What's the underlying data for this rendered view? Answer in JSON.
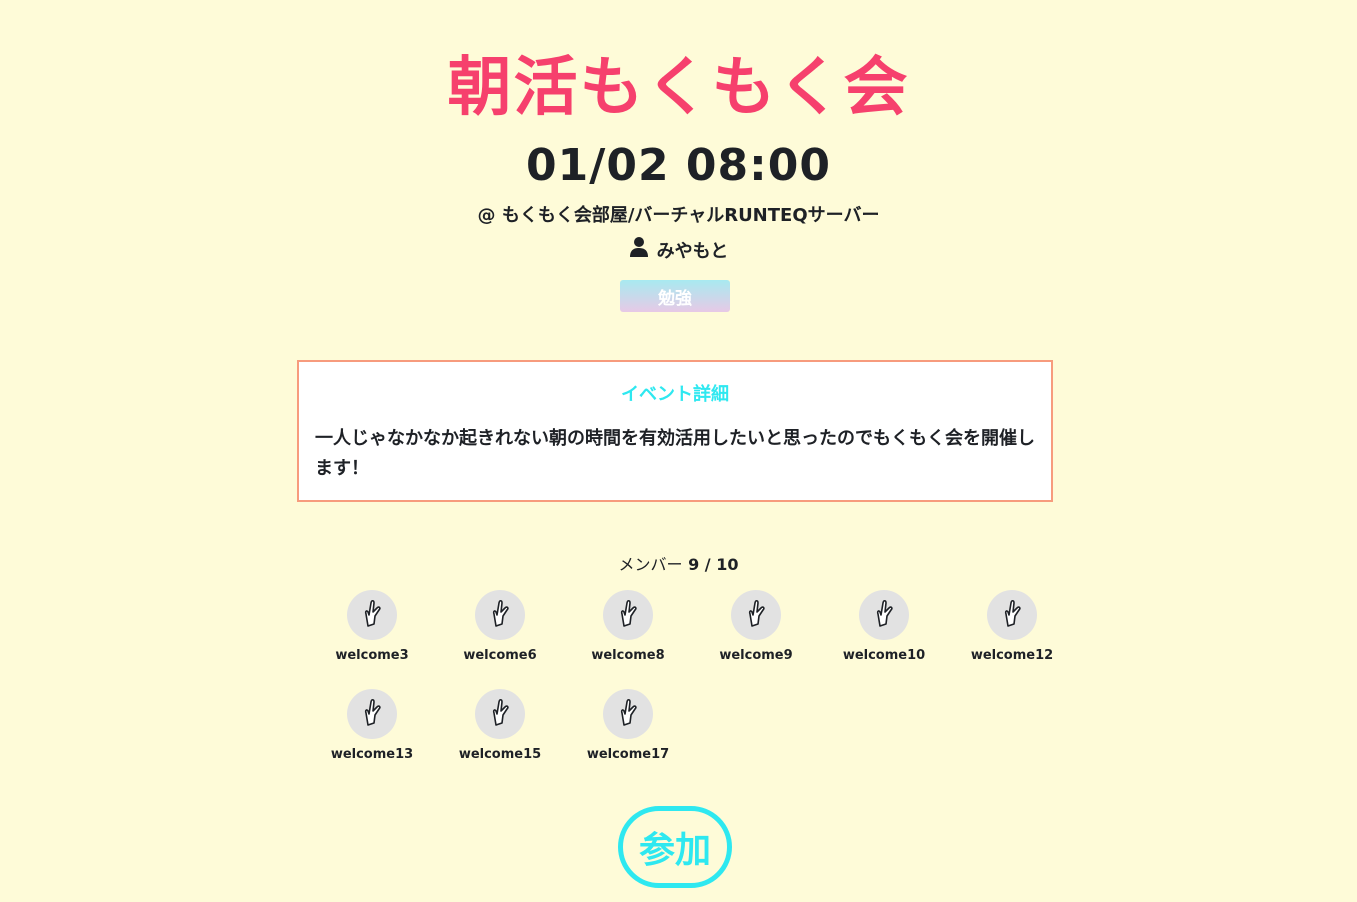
{
  "event": {
    "title": "朝活もくもく会",
    "datetime": "01/02 08:00",
    "location": "@ もくもく会部屋/バーチャルRUNTEQサーバー",
    "host": "みやもと",
    "tag": "勉強",
    "detail_heading": "イベント詳細",
    "detail_body": "一人じゃなかなか起きれない朝の時間を有効活用したいと思ったのでもくもく会を開催します！"
  },
  "members": {
    "label": "メンバー",
    "count": "9 / 10",
    "list": [
      {
        "name": "welcome3",
        "icon": "hand-icon"
      },
      {
        "name": "welcome6",
        "icon": "hand-icon"
      },
      {
        "name": "welcome8",
        "icon": "hand-icon"
      },
      {
        "name": "welcome9",
        "icon": "hand-icon"
      },
      {
        "name": "welcome10",
        "icon": "hand-icon"
      },
      {
        "name": "welcome12",
        "icon": "hand-icon"
      },
      {
        "name": "welcome13",
        "icon": "hand-icon"
      },
      {
        "name": "welcome15",
        "icon": "hand-icon"
      },
      {
        "name": "welcome17",
        "icon": "hand-icon"
      }
    ]
  },
  "actions": {
    "join_label": "参加"
  },
  "colors": {
    "background": "#fefbd8",
    "title": "#f6406d",
    "accent": "#2ee8f0",
    "detail_border": "#f79b7d"
  }
}
